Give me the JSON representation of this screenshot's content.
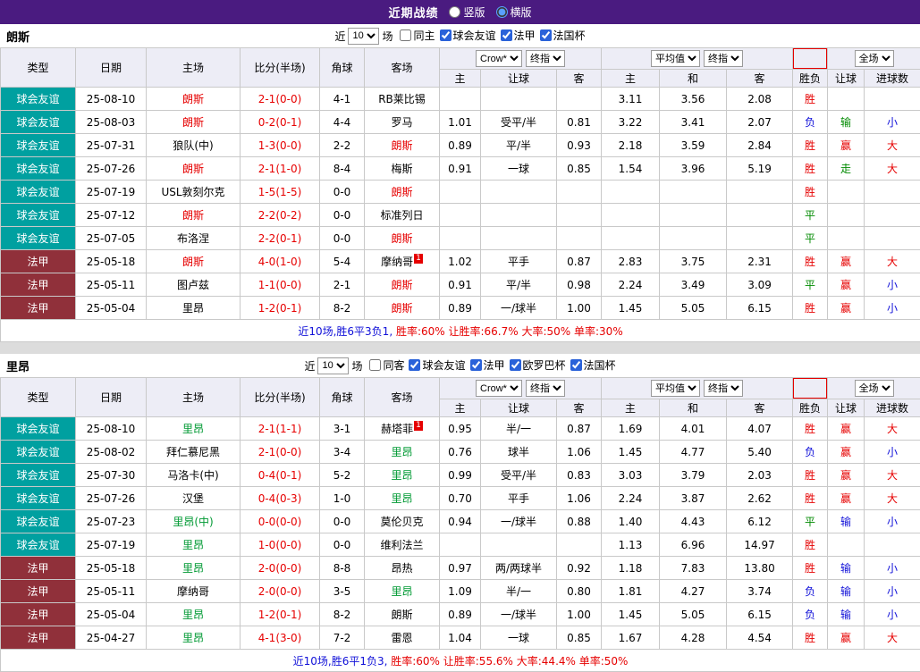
{
  "topbar": {
    "title": "近期战绩",
    "radios": [
      {
        "label": "竖版",
        "checked": false
      },
      {
        "label": "横版",
        "checked": true
      }
    ]
  },
  "colors": {
    "red": "#e60000",
    "green": "#008a00",
    "blue": "#1010d8",
    "score": "#e60000",
    "league_bg": {
      "friendly": "#00a0a0",
      "ligue1": "#90303a"
    }
  },
  "sections": [
    {
      "team": "朗斯",
      "accent": "#e60000",
      "filter": {
        "prefix": "近",
        "count": "10",
        "suffix": "场",
        "checkboxes": [
          {
            "label": "同主",
            "checked": false
          },
          {
            "label": "球会友谊",
            "checked": true
          },
          {
            "label": "法甲",
            "checked": true
          },
          {
            "label": "法国杯",
            "checked": true
          }
        ]
      },
      "header": {
        "cols": [
          "类型",
          "日期",
          "主场",
          "比分(半场)",
          "角球",
          "客场"
        ],
        "odds_dd1": "Crow*",
        "odds_dd2": "终指",
        "avg_dd1": "平均值",
        "avg_dd2": "终指",
        "scope_dd": "全场",
        "sub": [
          "主",
          "让球",
          "客",
          "主",
          "和",
          "客",
          "胜负",
          "让球",
          "进球数"
        ]
      },
      "rows": [
        {
          "league": "球会友谊",
          "league_key": "friendly",
          "date": "25-08-10",
          "home": "朗斯",
          "home_hl": true,
          "home_sup": "",
          "score": "2-1(0-0)",
          "corners": "4-1",
          "away": "RB莱比锡",
          "away_hl": false,
          "away_sup": "",
          "odds_home": "",
          "odds_hcap": "",
          "odds_away": "",
          "avg_home": "3.11",
          "avg_draw": "3.56",
          "avg_away": "2.08",
          "outcome": "胜",
          "outcome_c": "red",
          "hcap": "",
          "hcap_c": "",
          "goals": "",
          "goals_c": ""
        },
        {
          "league": "球会友谊",
          "league_key": "friendly",
          "date": "25-08-03",
          "home": "朗斯",
          "home_hl": true,
          "home_sup": "",
          "score": "0-2(0-1)",
          "corners": "4-4",
          "away": "罗马",
          "away_hl": false,
          "away_sup": "",
          "odds_home": "1.01",
          "odds_hcap": "受平/半",
          "odds_away": "0.81",
          "avg_home": "3.22",
          "avg_draw": "3.41",
          "avg_away": "2.07",
          "outcome": "负",
          "outcome_c": "blue",
          "hcap": "输",
          "hcap_c": "green",
          "goals": "小",
          "goals_c": "blue"
        },
        {
          "league": "球会友谊",
          "league_key": "friendly",
          "date": "25-07-31",
          "home": "狼队(中)",
          "home_hl": false,
          "home_sup": "",
          "score": "1-3(0-0)",
          "corners": "2-2",
          "away": "朗斯",
          "away_hl": true,
          "away_sup": "",
          "odds_home": "0.89",
          "odds_hcap": "平/半",
          "odds_away": "0.93",
          "avg_home": "2.18",
          "avg_draw": "3.59",
          "avg_away": "2.84",
          "outcome": "胜",
          "outcome_c": "red",
          "hcap": "赢",
          "hcap_c": "red",
          "goals": "大",
          "goals_c": "red"
        },
        {
          "league": "球会友谊",
          "league_key": "friendly",
          "date": "25-07-26",
          "home": "朗斯",
          "home_hl": true,
          "home_sup": "",
          "score": "2-1(1-0)",
          "corners": "8-4",
          "away": "梅斯",
          "away_hl": false,
          "away_sup": "",
          "odds_home": "0.91",
          "odds_hcap": "一球",
          "odds_away": "0.85",
          "avg_home": "1.54",
          "avg_draw": "3.96",
          "avg_away": "5.19",
          "outcome": "胜",
          "outcome_c": "red",
          "hcap": "走",
          "hcap_c": "green",
          "goals": "大",
          "goals_c": "red"
        },
        {
          "league": "球会友谊",
          "league_key": "friendly",
          "date": "25-07-19",
          "home": "USL敦刻尔克",
          "home_hl": false,
          "home_sup": "",
          "score": "1-5(1-5)",
          "corners": "0-0",
          "away": "朗斯",
          "away_hl": true,
          "away_sup": "",
          "odds_home": "",
          "odds_hcap": "",
          "odds_away": "",
          "avg_home": "",
          "avg_draw": "",
          "avg_away": "",
          "outcome": "胜",
          "outcome_c": "red",
          "hcap": "",
          "hcap_c": "",
          "goals": "",
          "goals_c": ""
        },
        {
          "league": "球会友谊",
          "league_key": "friendly",
          "date": "25-07-12",
          "home": "朗斯",
          "home_hl": true,
          "home_sup": "",
          "score": "2-2(0-2)",
          "corners": "0-0",
          "away": "标准列日",
          "away_hl": false,
          "away_sup": "",
          "odds_home": "",
          "odds_hcap": "",
          "odds_away": "",
          "avg_home": "",
          "avg_draw": "",
          "avg_away": "",
          "outcome": "平",
          "outcome_c": "green",
          "hcap": "",
          "hcap_c": "",
          "goals": "",
          "goals_c": ""
        },
        {
          "league": "球会友谊",
          "league_key": "friendly",
          "date": "25-07-05",
          "home": "布洛涅",
          "home_hl": false,
          "home_sup": "",
          "score": "2-2(0-1)",
          "corners": "0-0",
          "away": "朗斯",
          "away_hl": true,
          "away_sup": "",
          "odds_home": "",
          "odds_hcap": "",
          "odds_away": "",
          "avg_home": "",
          "avg_draw": "",
          "avg_away": "",
          "outcome": "平",
          "outcome_c": "green",
          "hcap": "",
          "hcap_c": "",
          "goals": "",
          "goals_c": ""
        },
        {
          "league": "法甲",
          "league_key": "ligue1",
          "date": "25-05-18",
          "home": "朗斯",
          "home_hl": true,
          "home_sup": "",
          "score": "4-0(1-0)",
          "corners": "5-4",
          "away": "摩纳哥",
          "away_hl": false,
          "away_sup": "1",
          "odds_home": "1.02",
          "odds_hcap": "平手",
          "odds_away": "0.87",
          "avg_home": "2.83",
          "avg_draw": "3.75",
          "avg_away": "2.31",
          "outcome": "胜",
          "outcome_c": "red",
          "hcap": "赢",
          "hcap_c": "red",
          "goals": "大",
          "goals_c": "red"
        },
        {
          "league": "法甲",
          "league_key": "ligue1",
          "date": "25-05-11",
          "home": "图卢兹",
          "home_hl": false,
          "home_sup": "",
          "score": "1-1(0-0)",
          "corners": "2-1",
          "away": "朗斯",
          "away_hl": true,
          "away_sup": "",
          "odds_home": "0.91",
          "odds_hcap": "平/半",
          "odds_away": "0.98",
          "avg_home": "2.24",
          "avg_draw": "3.49",
          "avg_away": "3.09",
          "outcome": "平",
          "outcome_c": "green",
          "hcap": "赢",
          "hcap_c": "red",
          "goals": "小",
          "goals_c": "blue"
        },
        {
          "league": "法甲",
          "league_key": "ligue1",
          "date": "25-05-04",
          "home": "里昂",
          "home_hl": false,
          "home_sup": "",
          "score": "1-2(0-1)",
          "corners": "8-2",
          "away": "朗斯",
          "away_hl": true,
          "away_sup": "",
          "odds_home": "0.89",
          "odds_hcap": "一/球半",
          "odds_away": "1.00",
          "avg_home": "1.45",
          "avg_draw": "5.05",
          "avg_away": "6.15",
          "outcome": "胜",
          "outcome_c": "red",
          "hcap": "赢",
          "hcap_c": "red",
          "goals": "小",
          "goals_c": "blue"
        }
      ],
      "summary": [
        {
          "text": "近10场,胜6平3负1,",
          "color": "blue"
        },
        {
          "text": " 胜率:60%",
          "color": "red"
        },
        {
          "text": " 让胜率:66.7%",
          "color": "red"
        },
        {
          "text": " 大率:50%",
          "color": "red"
        },
        {
          "text": " 单率:30%",
          "color": "red"
        }
      ]
    },
    {
      "team": "里昂",
      "accent": "#009933",
      "filter": {
        "prefix": "近",
        "count": "10",
        "suffix": "场",
        "checkboxes": [
          {
            "label": "同客",
            "checked": false
          },
          {
            "label": "球会友谊",
            "checked": true
          },
          {
            "label": "法甲",
            "checked": true
          },
          {
            "label": "欧罗巴杯",
            "checked": true
          },
          {
            "label": "法国杯",
            "checked": true
          }
        ]
      },
      "header": {
        "cols": [
          "类型",
          "日期",
          "主场",
          "比分(半场)",
          "角球",
          "客场"
        ],
        "odds_dd1": "Crow*",
        "odds_dd2": "终指",
        "avg_dd1": "平均值",
        "avg_dd2": "终指",
        "scope_dd": "全场",
        "sub": [
          "主",
          "让球",
          "客",
          "主",
          "和",
          "客",
          "胜负",
          "让球",
          "进球数"
        ]
      },
      "rows": [
        {
          "league": "球会友谊",
          "league_key": "friendly",
          "date": "25-08-10",
          "home": "里昂",
          "home_hl": true,
          "home_sup": "",
          "score": "2-1(1-1)",
          "corners": "3-1",
          "away": "赫塔菲",
          "away_hl": false,
          "away_sup": "1",
          "odds_home": "0.95",
          "odds_hcap": "半/一",
          "odds_away": "0.87",
          "avg_home": "1.69",
          "avg_draw": "4.01",
          "avg_away": "4.07",
          "outcome": "胜",
          "outcome_c": "red",
          "hcap": "赢",
          "hcap_c": "red",
          "goals": "大",
          "goals_c": "red"
        },
        {
          "league": "球会友谊",
          "league_key": "friendly",
          "date": "25-08-02",
          "home": "拜仁慕尼黑",
          "home_hl": false,
          "home_sup": "",
          "score": "2-1(0-0)",
          "corners": "3-4",
          "away": "里昂",
          "away_hl": true,
          "away_sup": "",
          "odds_home": "0.76",
          "odds_hcap": "球半",
          "odds_away": "1.06",
          "avg_home": "1.45",
          "avg_draw": "4.77",
          "avg_away": "5.40",
          "outcome": "负",
          "outcome_c": "blue",
          "hcap": "赢",
          "hcap_c": "red",
          "goals": "小",
          "goals_c": "blue"
        },
        {
          "league": "球会友谊",
          "league_key": "friendly",
          "date": "25-07-30",
          "home": "马洛卡(中)",
          "home_hl": false,
          "home_sup": "",
          "score": "0-4(0-1)",
          "corners": "5-2",
          "away": "里昂",
          "away_hl": true,
          "away_sup": "",
          "odds_home": "0.99",
          "odds_hcap": "受平/半",
          "odds_away": "0.83",
          "avg_home": "3.03",
          "avg_draw": "3.79",
          "avg_away": "2.03",
          "outcome": "胜",
          "outcome_c": "red",
          "hcap": "赢",
          "hcap_c": "red",
          "goals": "大",
          "goals_c": "red"
        },
        {
          "league": "球会友谊",
          "league_key": "friendly",
          "date": "25-07-26",
          "home": "汉堡",
          "home_hl": false,
          "home_sup": "",
          "score": "0-4(0-3)",
          "corners": "1-0",
          "away": "里昂",
          "away_hl": true,
          "away_sup": "",
          "odds_home": "0.70",
          "odds_hcap": "平手",
          "odds_away": "1.06",
          "avg_home": "2.24",
          "avg_draw": "3.87",
          "avg_away": "2.62",
          "outcome": "胜",
          "outcome_c": "red",
          "hcap": "赢",
          "hcap_c": "red",
          "goals": "大",
          "goals_c": "red"
        },
        {
          "league": "球会友谊",
          "league_key": "friendly",
          "date": "25-07-23",
          "home": "里昂(中)",
          "home_hl": true,
          "home_sup": "",
          "score": "0-0(0-0)",
          "corners": "0-0",
          "away": "莫伦贝克",
          "away_hl": false,
          "away_sup": "",
          "odds_home": "0.94",
          "odds_hcap": "一/球半",
          "odds_away": "0.88",
          "avg_home": "1.40",
          "avg_draw": "4.43",
          "avg_away": "6.12",
          "outcome": "平",
          "outcome_c": "green",
          "hcap": "输",
          "hcap_c": "blue",
          "goals": "小",
          "goals_c": "blue"
        },
        {
          "league": "球会友谊",
          "league_key": "friendly",
          "date": "25-07-19",
          "home": "里昂",
          "home_hl": true,
          "home_sup": "",
          "score": "1-0(0-0)",
          "corners": "0-0",
          "away": "维利法兰",
          "away_hl": false,
          "away_sup": "",
          "odds_home": "",
          "odds_hcap": "",
          "odds_away": "",
          "avg_home": "1.13",
          "avg_draw": "6.96",
          "avg_away": "14.97",
          "outcome": "胜",
          "outcome_c": "red",
          "hcap": "",
          "hcap_c": "",
          "goals": "",
          "goals_c": ""
        },
        {
          "league": "法甲",
          "league_key": "ligue1",
          "date": "25-05-18",
          "home": "里昂",
          "home_hl": true,
          "home_sup": "",
          "score": "2-0(0-0)",
          "corners": "8-8",
          "away": "昂热",
          "away_hl": false,
          "away_sup": "",
          "odds_home": "0.97",
          "odds_hcap": "两/两球半",
          "odds_away": "0.92",
          "avg_home": "1.18",
          "avg_draw": "7.83",
          "avg_away": "13.80",
          "outcome": "胜",
          "outcome_c": "red",
          "hcap": "输",
          "hcap_c": "blue",
          "goals": "小",
          "goals_c": "blue"
        },
        {
          "league": "法甲",
          "league_key": "ligue1",
          "date": "25-05-11",
          "home": "摩纳哥",
          "home_hl": false,
          "home_sup": "",
          "score": "2-0(0-0)",
          "corners": "3-5",
          "away": "里昂",
          "away_hl": true,
          "away_sup": "",
          "odds_home": "1.09",
          "odds_hcap": "半/一",
          "odds_away": "0.80",
          "avg_home": "1.81",
          "avg_draw": "4.27",
          "avg_away": "3.74",
          "outcome": "负",
          "outcome_c": "blue",
          "hcap": "输",
          "hcap_c": "blue",
          "goals": "小",
          "goals_c": "blue"
        },
        {
          "league": "法甲",
          "league_key": "ligue1",
          "date": "25-05-04",
          "home": "里昂",
          "home_hl": true,
          "home_sup": "",
          "score": "1-2(0-1)",
          "corners": "8-2",
          "away": "朗斯",
          "away_hl": false,
          "away_sup": "",
          "odds_home": "0.89",
          "odds_hcap": "一/球半",
          "odds_away": "1.00",
          "avg_home": "1.45",
          "avg_draw": "5.05",
          "avg_away": "6.15",
          "outcome": "负",
          "outcome_c": "blue",
          "hcap": "输",
          "hcap_c": "blue",
          "goals": "小",
          "goals_c": "blue"
        },
        {
          "league": "法甲",
          "league_key": "ligue1",
          "date": "25-04-27",
          "home": "里昂",
          "home_hl": true,
          "home_sup": "",
          "score": "4-1(3-0)",
          "corners": "7-2",
          "away": "雷恩",
          "away_hl": false,
          "away_sup": "",
          "odds_home": "1.04",
          "odds_hcap": "一球",
          "odds_away": "0.85",
          "avg_home": "1.67",
          "avg_draw": "4.28",
          "avg_away": "4.54",
          "outcome": "胜",
          "outcome_c": "red",
          "hcap": "赢",
          "hcap_c": "red",
          "goals": "大",
          "goals_c": "red"
        }
      ],
      "summary": [
        {
          "text": "近10场,胜6平1负3,",
          "color": "blue"
        },
        {
          "text": " 胜率:60%",
          "color": "red"
        },
        {
          "text": " 让胜率:55.6%",
          "color": "red"
        },
        {
          "text": " 大率:44.4%",
          "color": "red"
        },
        {
          "text": " 单率:50%",
          "color": "red"
        }
      ]
    }
  ]
}
